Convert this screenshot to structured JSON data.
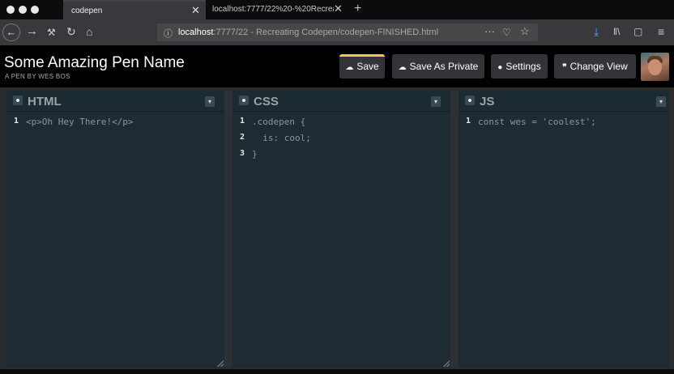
{
  "browser": {
    "tabs": [
      {
        "label": "codepen",
        "active": true
      },
      {
        "label": "localhost:7777/22%20-%20Recreati",
        "active": false
      }
    ],
    "new_tab_label": "+",
    "close_glyph": "✕",
    "url": {
      "host": "localhost",
      "rest": ":7777/22 - Recreating Codepen/codepen-FINISHED.html"
    },
    "url_actions": [
      "more-icon",
      "pocket-icon",
      "bookmark-star-icon"
    ],
    "toolbar_icons": [
      "download-icon",
      "library-icon",
      "sidebar-icon",
      "menu-icon"
    ]
  },
  "pen": {
    "title": "Some Amazing Pen Name",
    "subtitle": "A PEN BY WES BOS",
    "buttons": {
      "save": "Save",
      "save_private": "Save As Private",
      "settings": "Settings",
      "change_view": "Change View"
    },
    "accent_color": "#f2c94c"
  },
  "editors": [
    {
      "name": "HTML",
      "lines": [
        "<p>Oh Hey There!</p>"
      ]
    },
    {
      "name": "CSS",
      "lines": [
        ".codepen {",
        "  is: cool;",
        "}"
      ]
    },
    {
      "name": "JS",
      "lines": [
        "const wes = 'coolest';"
      ]
    }
  ],
  "line_numbers": [
    "1",
    "2",
    "3"
  ]
}
